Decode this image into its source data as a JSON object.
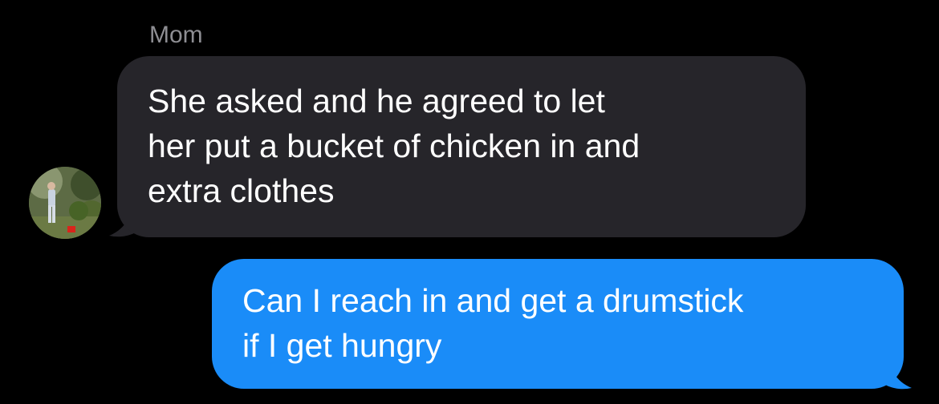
{
  "conversation": {
    "sender_name": "Mom",
    "messages": [
      {
        "direction": "incoming",
        "text": "She asked and he agreed to let\nher put a bucket of chicken in and\nextra clothes"
      },
      {
        "direction": "outgoing",
        "text": "Can I reach in and get a drumstick\nif I get hungry"
      }
    ]
  },
  "colors": {
    "background": "#000000",
    "incoming_bubble": "#26252a",
    "outgoing_bubble": "#1a8cf8",
    "sender_name": "#8e8e93",
    "message_text": "#ffffff"
  }
}
